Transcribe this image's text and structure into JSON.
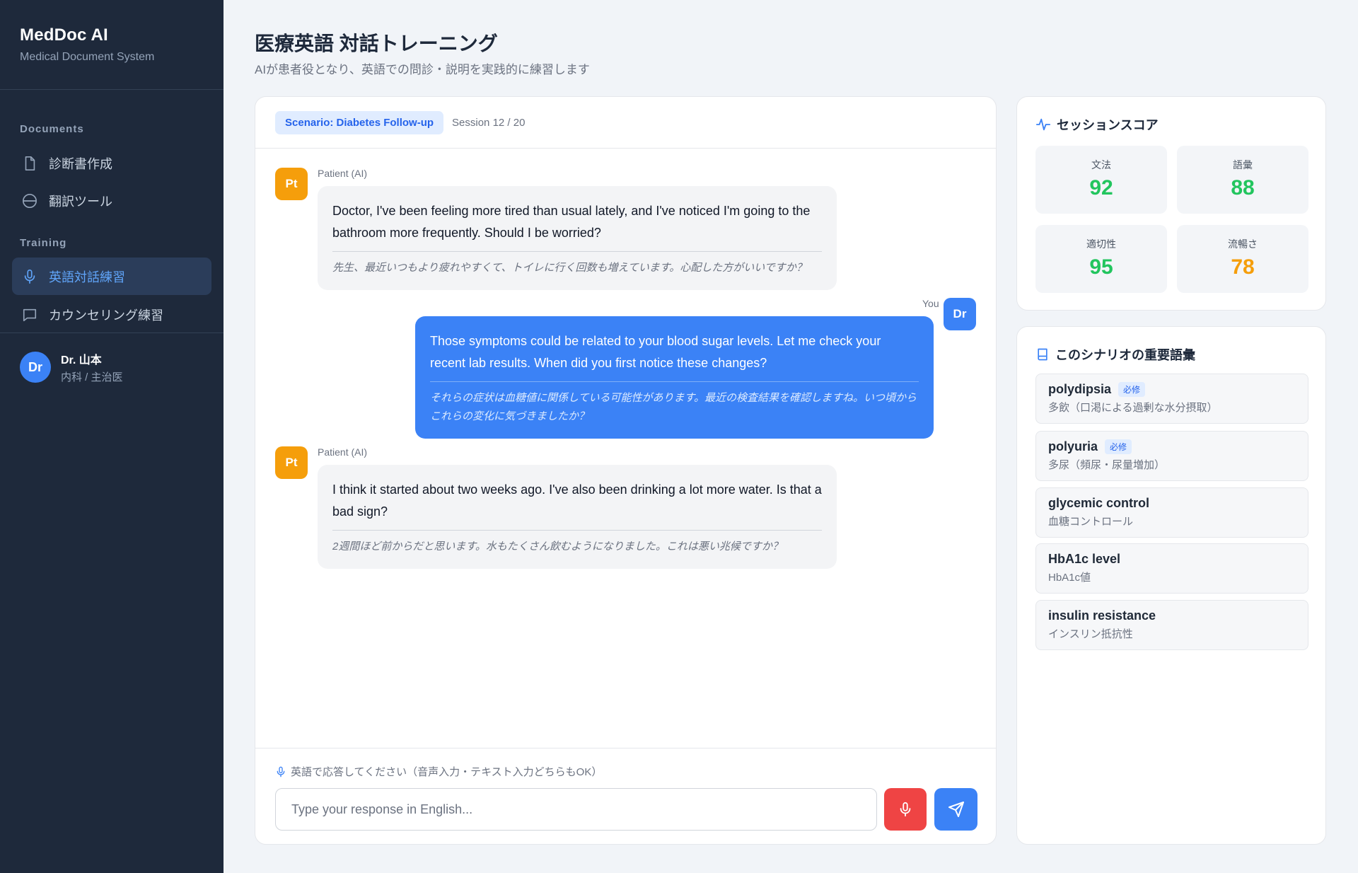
{
  "app": {
    "title": "MedDoc AI",
    "subtitle": "Medical Document System"
  },
  "sidebar": {
    "sections": [
      {
        "label": "Documents"
      },
      {
        "label": "Training"
      }
    ],
    "items": [
      {
        "label": "診断書作成",
        "icon": "document-icon"
      },
      {
        "label": "翻訳ツール",
        "icon": "globe-icon"
      },
      {
        "label": "英語対話練習",
        "icon": "microphone-icon",
        "active": true
      },
      {
        "label": "カウンセリング練習",
        "icon": "chat-bubble-icon"
      }
    ],
    "user": {
      "initials": "Dr",
      "name": "Dr. 山本",
      "role": "内科 / 主治医"
    }
  },
  "header": {
    "title": "医療英語 対話トレーニング",
    "subtitle": "AIが患者役となり、英語での問診・説明を実践的に練習します"
  },
  "chat": {
    "scenario": "Scenario: Diabetes Follow-up",
    "session": "Session 12 / 20",
    "messages": [
      {
        "role": "patient",
        "avatar": "Pt",
        "sender": "Patient (AI)",
        "text": "Doctor, I've been feeling more tired than usual lately, and I've noticed I'm going to the bathroom more frequently. Should I be worried?",
        "translation": "先生、最近いつもより疲れやすくて、トイレに行く回数も増えています。心配した方がいいですか？"
      },
      {
        "role": "doctor",
        "avatar": "Dr",
        "sender": "You",
        "text": "Those symptoms could be related to your blood sugar levels. Let me check your recent lab results. When did you first notice these changes?",
        "translation": "それらの症状は血糖値に関係している可能性があります。最近の検査結果を確認しますね。いつ頃からこれらの変化に気づきましたか？"
      },
      {
        "role": "patient",
        "avatar": "Pt",
        "sender": "Patient (AI)",
        "text": "I think it started about two weeks ago. I've also been drinking a lot more water. Is that a bad sign?",
        "translation": "2週間ほど前からだと思います。水もたくさん飲むようになりました。これは悪い兆候ですか？"
      }
    ],
    "input_hint": "英語で応答してください（音声入力・テキスト入力どちらもOK）",
    "input_placeholder": "Type your response in English...",
    "input_value": ""
  },
  "score": {
    "title": "セッションスコア",
    "items": [
      {
        "label": "文法",
        "value": "92",
        "color": "#22c55e"
      },
      {
        "label": "語彙",
        "value": "88",
        "color": "#22c55e"
      },
      {
        "label": "適切性",
        "value": "95",
        "color": "#22c55e"
      },
      {
        "label": "流暢さ",
        "value": "78",
        "color": "#f59e0b"
      }
    ]
  },
  "vocab": {
    "title": "このシナリオの重要語彙",
    "items": [
      {
        "term": "polydipsia",
        "badge": "必修",
        "definition": "多飲（口渇による過剰な水分摂取）"
      },
      {
        "term": "polyuria",
        "badge": "必修",
        "definition": "多尿（頻尿・尿量増加）"
      },
      {
        "term": "glycemic control",
        "definition": "血糖コントロール"
      },
      {
        "term": "HbA1c level",
        "definition": "HbA1c値"
      },
      {
        "term": "insulin resistance",
        "definition": "インスリン抵抗性"
      }
    ]
  },
  "colors": {
    "accent": "#3b82f6",
    "sidebar": "#1e293b",
    "patient_avatar": "#f59e0b",
    "mic_button": "#ef4444"
  }
}
